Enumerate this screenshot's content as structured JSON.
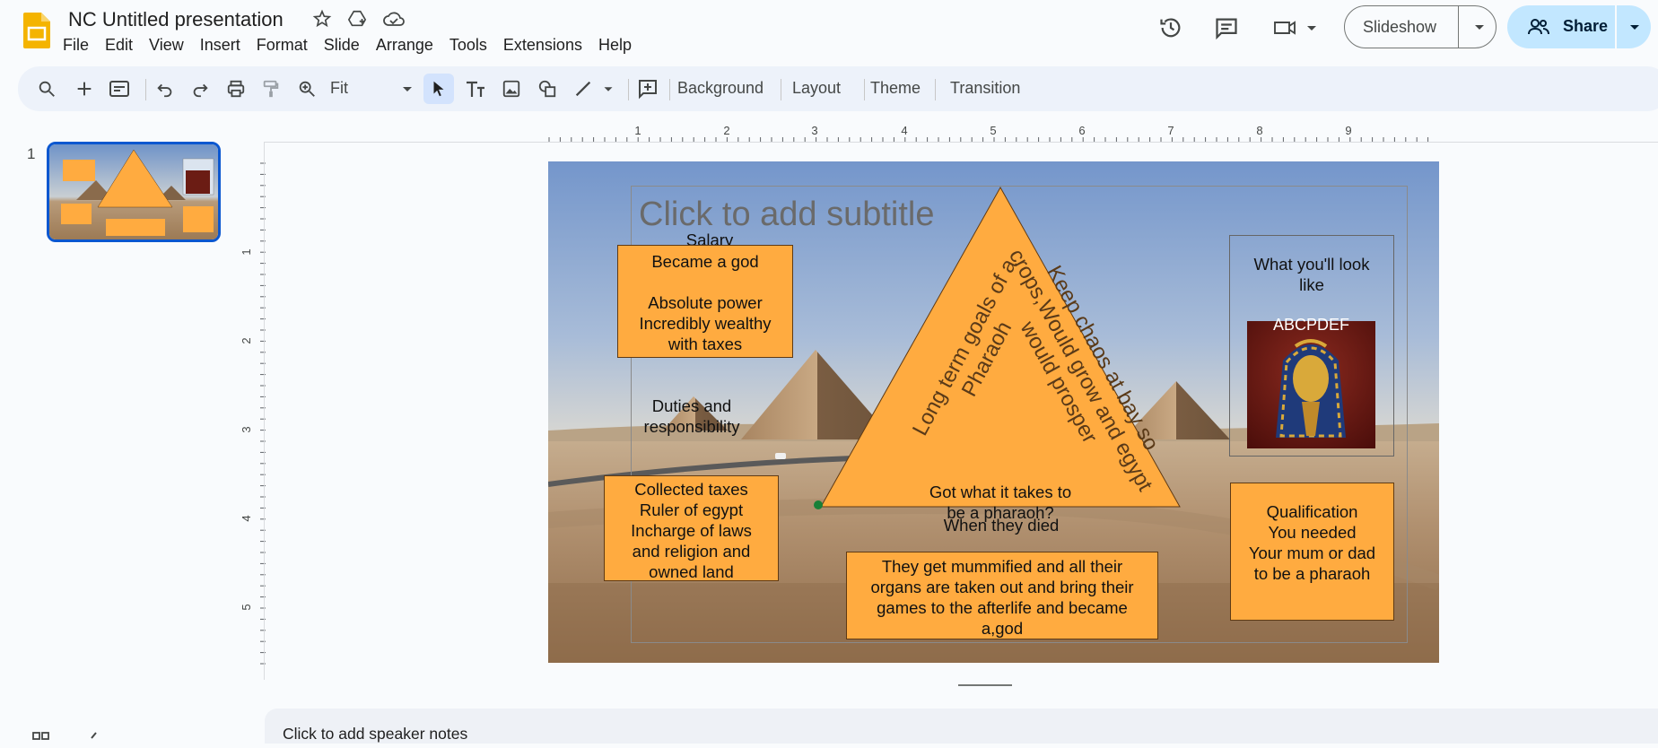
{
  "app": {
    "doc_title": "NC Untitled presentation",
    "menu": [
      "File",
      "Edit",
      "View",
      "Insert",
      "Format",
      "Slide",
      "Arrange",
      "Tools",
      "Extensions",
      "Help"
    ],
    "slideshow_label": "Slideshow",
    "share_label": "Share",
    "brand_color": "#f4b400",
    "accent_color": "#0b57d0",
    "share_bg": "#c2e7ff"
  },
  "toolbar": {
    "zoom_value": "Fit",
    "background_label": "Background",
    "layout_label": "Layout",
    "theme_label": "Theme",
    "transition_label": "Transition",
    "icons": [
      "search-icon",
      "new-slide-icon",
      "slide-layout-icon",
      "undo-icon",
      "redo-icon",
      "print-icon",
      "paint-format-icon",
      "zoom-icon",
      "select-icon",
      "text-box-icon",
      "image-icon",
      "shape-icon",
      "line-icon",
      "comment-add-icon"
    ]
  },
  "filmstrip": {
    "slide_number": "1"
  },
  "ruler": {
    "horizontal_marks": [
      "1",
      "2",
      "3",
      "4",
      "5",
      "6",
      "7",
      "8",
      "9"
    ],
    "vertical_marks": [
      "1",
      "2",
      "3",
      "4",
      "5"
    ]
  },
  "slide": {
    "subtitle_placeholder": "Click to add subtitle",
    "salary_heading": "Salary",
    "salary_body": "Became a god\n\nAbsolute power\nIncredibly wealthy\nwith taxes",
    "duties_heading": "Duties and\nresponsibility",
    "duties_body": "Collected taxes\nRuler of egypt\nIncharge of laws\nand religion and\nowned land",
    "triangle_left": "Long term goals of a Pharaoh",
    "triangle_right": "Keep chaos at bay so crops,Would grow and egypt would prosper",
    "triangle_bottom": "Got what it takes to\nbe a pharaoh?",
    "death_heading": "When they died",
    "death_body": "They get mummified and all their\norgans are taken out and bring their\ngames to the afterlife and became\na,god",
    "look_heading": "What you'll look\nlike",
    "image_caption": "ABCPDEF",
    "qualification_body": "Qualification\nYou needed\nYour mum or dad\nto be a pharaoh"
  },
  "notes": {
    "placeholder": "Click to add speaker notes"
  }
}
